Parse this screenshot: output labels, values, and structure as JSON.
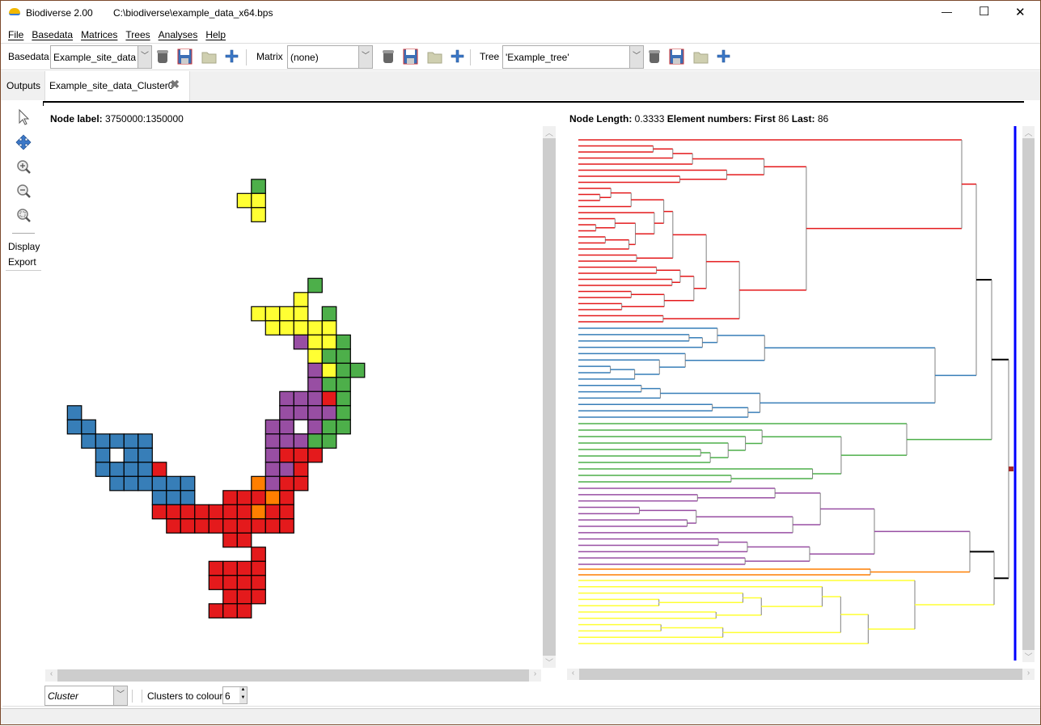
{
  "window": {
    "app_title": "Biodiverse 2.00",
    "file_path": "C:\\biodiverse\\example_data_x64.bps",
    "minimize": "—",
    "maximize": "☐",
    "close": "✕"
  },
  "menu": [
    "File",
    "Basedata",
    "Matrices",
    "Trees",
    "Analyses",
    "Help"
  ],
  "toolbar": {
    "basedata_label": "Basedata",
    "basedata_value": "Example_site_data",
    "matrix_label": "Matrix",
    "matrix_value": "(none)",
    "tree_label": "Tree",
    "tree_value": "'Example_tree'"
  },
  "tabs": {
    "outputs": "Outputs",
    "active": "Example_site_data_Cluster0"
  },
  "tools": {
    "display": "Display",
    "export": "Export"
  },
  "map": {
    "node_label_key": "Node label:",
    "node_label_value": "3750000:1350000"
  },
  "tree": {
    "node_length_key": "Node Length:",
    "node_length_value": "0.3333",
    "element_numbers_key": "Element numbers: First",
    "first": "86",
    "last_key": "Last:",
    "last": "86"
  },
  "bottom": {
    "colour_mode": "Cluster",
    "clusters_to_colour_label": "Clusters to colour",
    "clusters_to_colour_value": "6"
  },
  "colors": {
    "red": "#e41a1c",
    "blue": "#377eb8",
    "green": "#4daf4a",
    "purple": "#984ea3",
    "orange": "#ff7f00",
    "yellow": "#ffff33",
    "empty": "#ffffff"
  },
  "grid_cells": [
    [
      -7,
      [
        [
          13,
          "green"
        ]
      ]
    ],
    [
      -6,
      [
        [
          12,
          "yellow"
        ],
        [
          13,
          "yellow"
        ]
      ]
    ],
    [
      -5,
      [
        [
          13,
          "yellow"
        ]
      ]
    ],
    [
      0,
      [
        [
          17,
          "green"
        ]
      ]
    ],
    [
      1,
      [
        [
          16,
          "yellow"
        ]
      ]
    ],
    [
      2,
      [
        [
          13,
          "yellow"
        ],
        [
          14,
          "yellow"
        ],
        [
          15,
          "yellow"
        ],
        [
          16,
          "yellow"
        ],
        [
          18,
          "green"
        ]
      ]
    ],
    [
      3,
      [
        [
          14,
          "yellow"
        ],
        [
          15,
          "yellow"
        ],
        [
          16,
          "yellow"
        ],
        [
          17,
          "yellow"
        ],
        [
          18,
          "yellow"
        ]
      ]
    ],
    [
      4,
      [
        [
          16,
          "purple"
        ],
        [
          17,
          "yellow"
        ],
        [
          18,
          "yellow"
        ],
        [
          19,
          "green"
        ]
      ]
    ],
    [
      5,
      [
        [
          17,
          "yellow"
        ],
        [
          18,
          "green"
        ],
        [
          19,
          "green"
        ]
      ]
    ],
    [
      6,
      [
        [
          17,
          "purple"
        ],
        [
          18,
          "yellow"
        ],
        [
          19,
          "green"
        ],
        [
          20,
          "green"
        ]
      ]
    ],
    [
      7,
      [
        [
          17,
          "purple"
        ],
        [
          18,
          "green"
        ],
        [
          19,
          "green"
        ]
      ]
    ],
    [
      8,
      [
        [
          15,
          "purple"
        ],
        [
          16,
          "purple"
        ],
        [
          17,
          "purple"
        ],
        [
          18,
          "red"
        ],
        [
          19,
          "green"
        ]
      ]
    ],
    [
      9,
      [
        [
          0,
          "blue"
        ],
        [
          15,
          "purple"
        ],
        [
          16,
          "purple"
        ],
        [
          17,
          "purple"
        ],
        [
          18,
          "purple"
        ],
        [
          19,
          "green"
        ]
      ]
    ],
    [
      10,
      [
        [
          0,
          "blue"
        ],
        [
          1,
          "blue"
        ],
        [
          14,
          "purple"
        ],
        [
          15,
          "purple"
        ],
        [
          16,
          "empty"
        ],
        [
          17,
          "purple"
        ],
        [
          18,
          "green"
        ],
        [
          19,
          "green"
        ]
      ]
    ],
    [
      11,
      [
        [
          1,
          "blue"
        ],
        [
          2,
          "blue"
        ],
        [
          3,
          "blue"
        ],
        [
          4,
          "blue"
        ],
        [
          5,
          "blue"
        ],
        [
          14,
          "purple"
        ],
        [
          15,
          "purple"
        ],
        [
          16,
          "purple"
        ],
        [
          17,
          "green"
        ],
        [
          18,
          "green"
        ]
      ]
    ],
    [
      12,
      [
        [
          2,
          "blue"
        ],
        [
          3,
          "empty"
        ],
        [
          4,
          "blue"
        ],
        [
          5,
          "blue"
        ],
        [
          14,
          "purple"
        ],
        [
          15,
          "red"
        ],
        [
          16,
          "red"
        ],
        [
          17,
          "red"
        ]
      ]
    ],
    [
      13,
      [
        [
          2,
          "blue"
        ],
        [
          3,
          "blue"
        ],
        [
          4,
          "blue"
        ],
        [
          5,
          "blue"
        ],
        [
          6,
          "red"
        ],
        [
          14,
          "purple"
        ],
        [
          15,
          "purple"
        ],
        [
          16,
          "red"
        ]
      ]
    ],
    [
      14,
      [
        [
          3,
          "blue"
        ],
        [
          4,
          "blue"
        ],
        [
          5,
          "blue"
        ],
        [
          6,
          "blue"
        ],
        [
          7,
          "blue"
        ],
        [
          8,
          "blue"
        ],
        [
          13,
          "orange"
        ],
        [
          14,
          "purple"
        ],
        [
          15,
          "red"
        ],
        [
          16,
          "red"
        ]
      ]
    ],
    [
      15,
      [
        [
          6,
          "blue"
        ],
        [
          7,
          "blue"
        ],
        [
          8,
          "blue"
        ],
        [
          11,
          "red"
        ],
        [
          12,
          "red"
        ],
        [
          13,
          "red"
        ],
        [
          14,
          "orange"
        ],
        [
          15,
          "red"
        ]
      ]
    ],
    [
      16,
      [
        [
          6,
          "red"
        ],
        [
          7,
          "red"
        ],
        [
          8,
          "red"
        ],
        [
          9,
          "red"
        ],
        [
          10,
          "red"
        ],
        [
          11,
          "red"
        ],
        [
          12,
          "red"
        ],
        [
          13,
          "orange"
        ],
        [
          14,
          "red"
        ],
        [
          15,
          "red"
        ]
      ]
    ],
    [
      17,
      [
        [
          7,
          "red"
        ],
        [
          8,
          "red"
        ],
        [
          9,
          "red"
        ],
        [
          10,
          "red"
        ],
        [
          11,
          "red"
        ],
        [
          12,
          "red"
        ],
        [
          13,
          "red"
        ],
        [
          14,
          "red"
        ],
        [
          15,
          "red"
        ]
      ]
    ],
    [
      18,
      [
        [
          11,
          "red"
        ],
        [
          12,
          "red"
        ]
      ]
    ],
    [
      19,
      [
        [
          13,
          "red"
        ]
      ]
    ],
    [
      20,
      [
        [
          10,
          "red"
        ],
        [
          11,
          "red"
        ],
        [
          12,
          "red"
        ],
        [
          13,
          "red"
        ]
      ]
    ],
    [
      21,
      [
        [
          10,
          "red"
        ],
        [
          11,
          "red"
        ],
        [
          12,
          "red"
        ],
        [
          13,
          "red"
        ]
      ]
    ],
    [
      22,
      [
        [
          11,
          "red"
        ],
        [
          12,
          "red"
        ],
        [
          13,
          "red"
        ]
      ]
    ],
    [
      23,
      [
        [
          10,
          "red"
        ],
        [
          11,
          "red"
        ],
        [
          12,
          "red"
        ]
      ]
    ]
  ],
  "tree_clusters": [
    {
      "color": "red",
      "leaves": 31
    },
    {
      "color": "blue",
      "leaves": 15
    },
    {
      "color": "green",
      "leaves": 10
    },
    {
      "color": "purple",
      "leaves": 13
    },
    {
      "color": "orange",
      "leaves": 2
    },
    {
      "color": "yellow",
      "leaves": 11
    }
  ]
}
